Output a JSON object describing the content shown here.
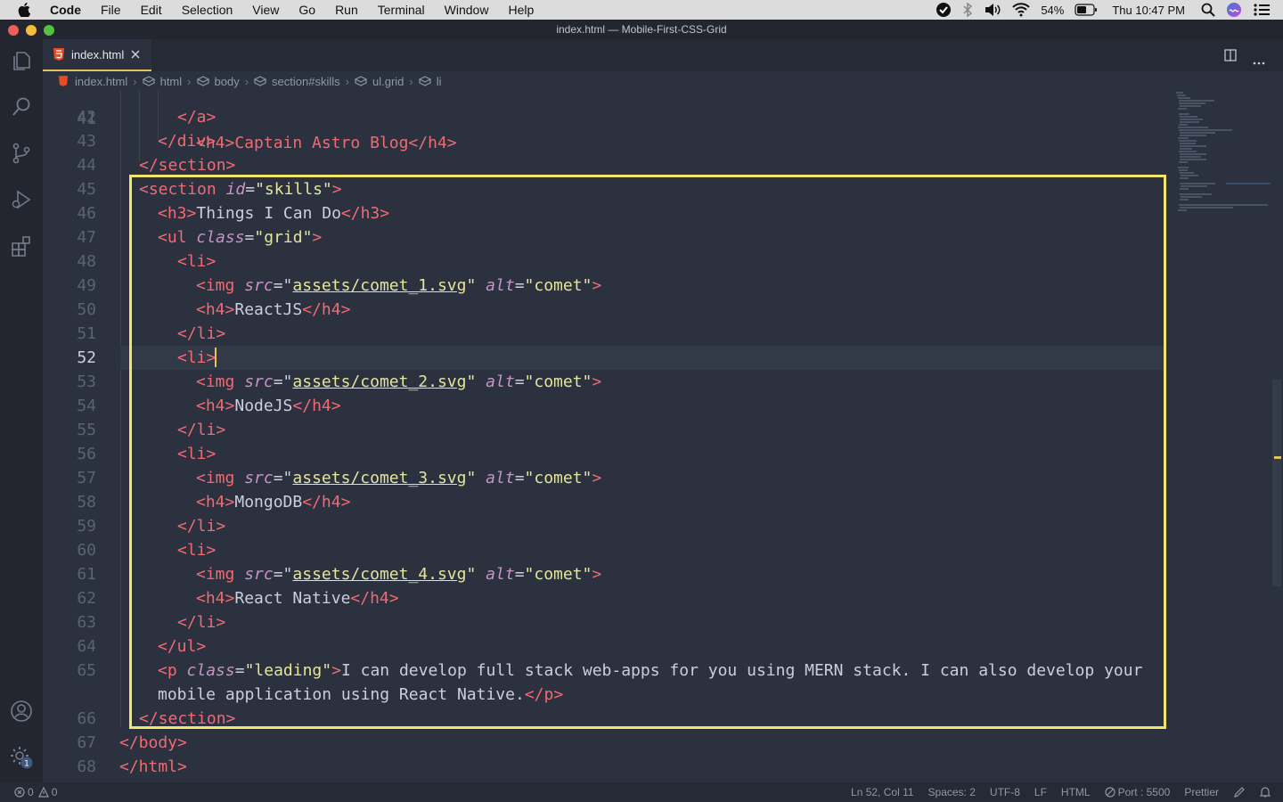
{
  "menubar": {
    "app": "Code",
    "items": [
      "File",
      "Edit",
      "Selection",
      "View",
      "Go",
      "Run",
      "Terminal",
      "Window",
      "Help"
    ],
    "battery": "54%",
    "clock": "Thu 10:47 PM"
  },
  "window": {
    "title": "index.html — Mobile-First-CSS-Grid"
  },
  "tab": {
    "label": "index.html"
  },
  "breadcrumb": [
    "index.html",
    "html",
    "body",
    "section#skills",
    "ul.grid",
    "li"
  ],
  "editor": {
    "first_partial_line_number": "41",
    "first_partial_line_text": "<h4>Captain Astro Blog</h4>",
    "lines": [
      {
        "n": "42"
      },
      {
        "n": "43"
      },
      {
        "n": "44"
      },
      {
        "n": "45"
      },
      {
        "n": "46"
      },
      {
        "n": "47"
      },
      {
        "n": "48"
      },
      {
        "n": "49"
      },
      {
        "n": "50"
      },
      {
        "n": "51"
      },
      {
        "n": "52"
      },
      {
        "n": "53"
      },
      {
        "n": "54"
      },
      {
        "n": "55"
      },
      {
        "n": "56"
      },
      {
        "n": "57"
      },
      {
        "n": "58"
      },
      {
        "n": "59"
      },
      {
        "n": "60"
      },
      {
        "n": "61"
      },
      {
        "n": "62"
      },
      {
        "n": "63"
      },
      {
        "n": "64"
      },
      {
        "n": "65"
      },
      {
        "n": ""
      },
      {
        "n": "66"
      },
      {
        "n": "67"
      },
      {
        "n": "68"
      }
    ],
    "code": {
      "l42_close_a": "</a>",
      "l43": "</div>",
      "l44": "</section>",
      "section_open": "<section",
      "id_attr": "id",
      "skills_val": "\"skills\"",
      "h3_open": "<h3>",
      "h3_text": "Things I Can Do",
      "h3_close": "</h3>",
      "ul_open": "<ul",
      "class_attr": "class",
      "grid_val": "\"grid\"",
      "li_open": "<li>",
      "li_close": "</li>",
      "img_open": "<img",
      "src_attr": "src",
      "alt_attr": "alt",
      "comet_val": "\"comet\"",
      "src1": "assets/comet_1.svg",
      "src2": "assets/comet_2.svg",
      "src3": "assets/comet_3.svg",
      "src4": "assets/comet_4.svg",
      "h4_open": "<h4>",
      "h4_close": "</h4>",
      "h4_1": "ReactJS",
      "h4_2": "NodeJS",
      "h4_3": "MongoDB",
      "h4_4": "React Native",
      "ul_close": "</ul>",
      "p_open": "<p",
      "leading_val": "\"leading\"",
      "p_text_1": "I can develop full stack web-apps for you using MERN stack. I can also develop your",
      "p_text_2": "mobile application using React Native.",
      "p_close": "</p>",
      "section_close": "</section>",
      "body_close": "</body>",
      "html_close": "</html>"
    }
  },
  "statusbar": {
    "errors": "0",
    "warnings": "0",
    "position": "Ln 52, Col 11",
    "spaces": "Spaces: 2",
    "encoding": "UTF-8",
    "eol": "LF",
    "language": "HTML",
    "port": "Port : 5500",
    "formatter": "Prettier"
  },
  "activity": {
    "badge": "1"
  },
  "colors": {
    "highlight_border": "#f2e66a",
    "tag": "#ef6b73",
    "attr": "#c594c5",
    "string": "#e5e59a",
    "editor_bg": "#2b313f"
  },
  "icons": [
    "apple-icon",
    "explorer-icon",
    "search-icon",
    "source-control-icon",
    "run-debug-icon",
    "extensions-icon",
    "account-icon",
    "settings-gear-icon",
    "split-editor-icon",
    "more-actions-icon",
    "html-file-icon",
    "close-icon",
    "error-icon",
    "warning-icon",
    "wifi-icon",
    "battery-icon",
    "volume-icon",
    "bluetooth-icon",
    "spotlight-icon",
    "siri-icon",
    "control-center-icon",
    "bell-icon",
    "feedback-icon"
  ]
}
